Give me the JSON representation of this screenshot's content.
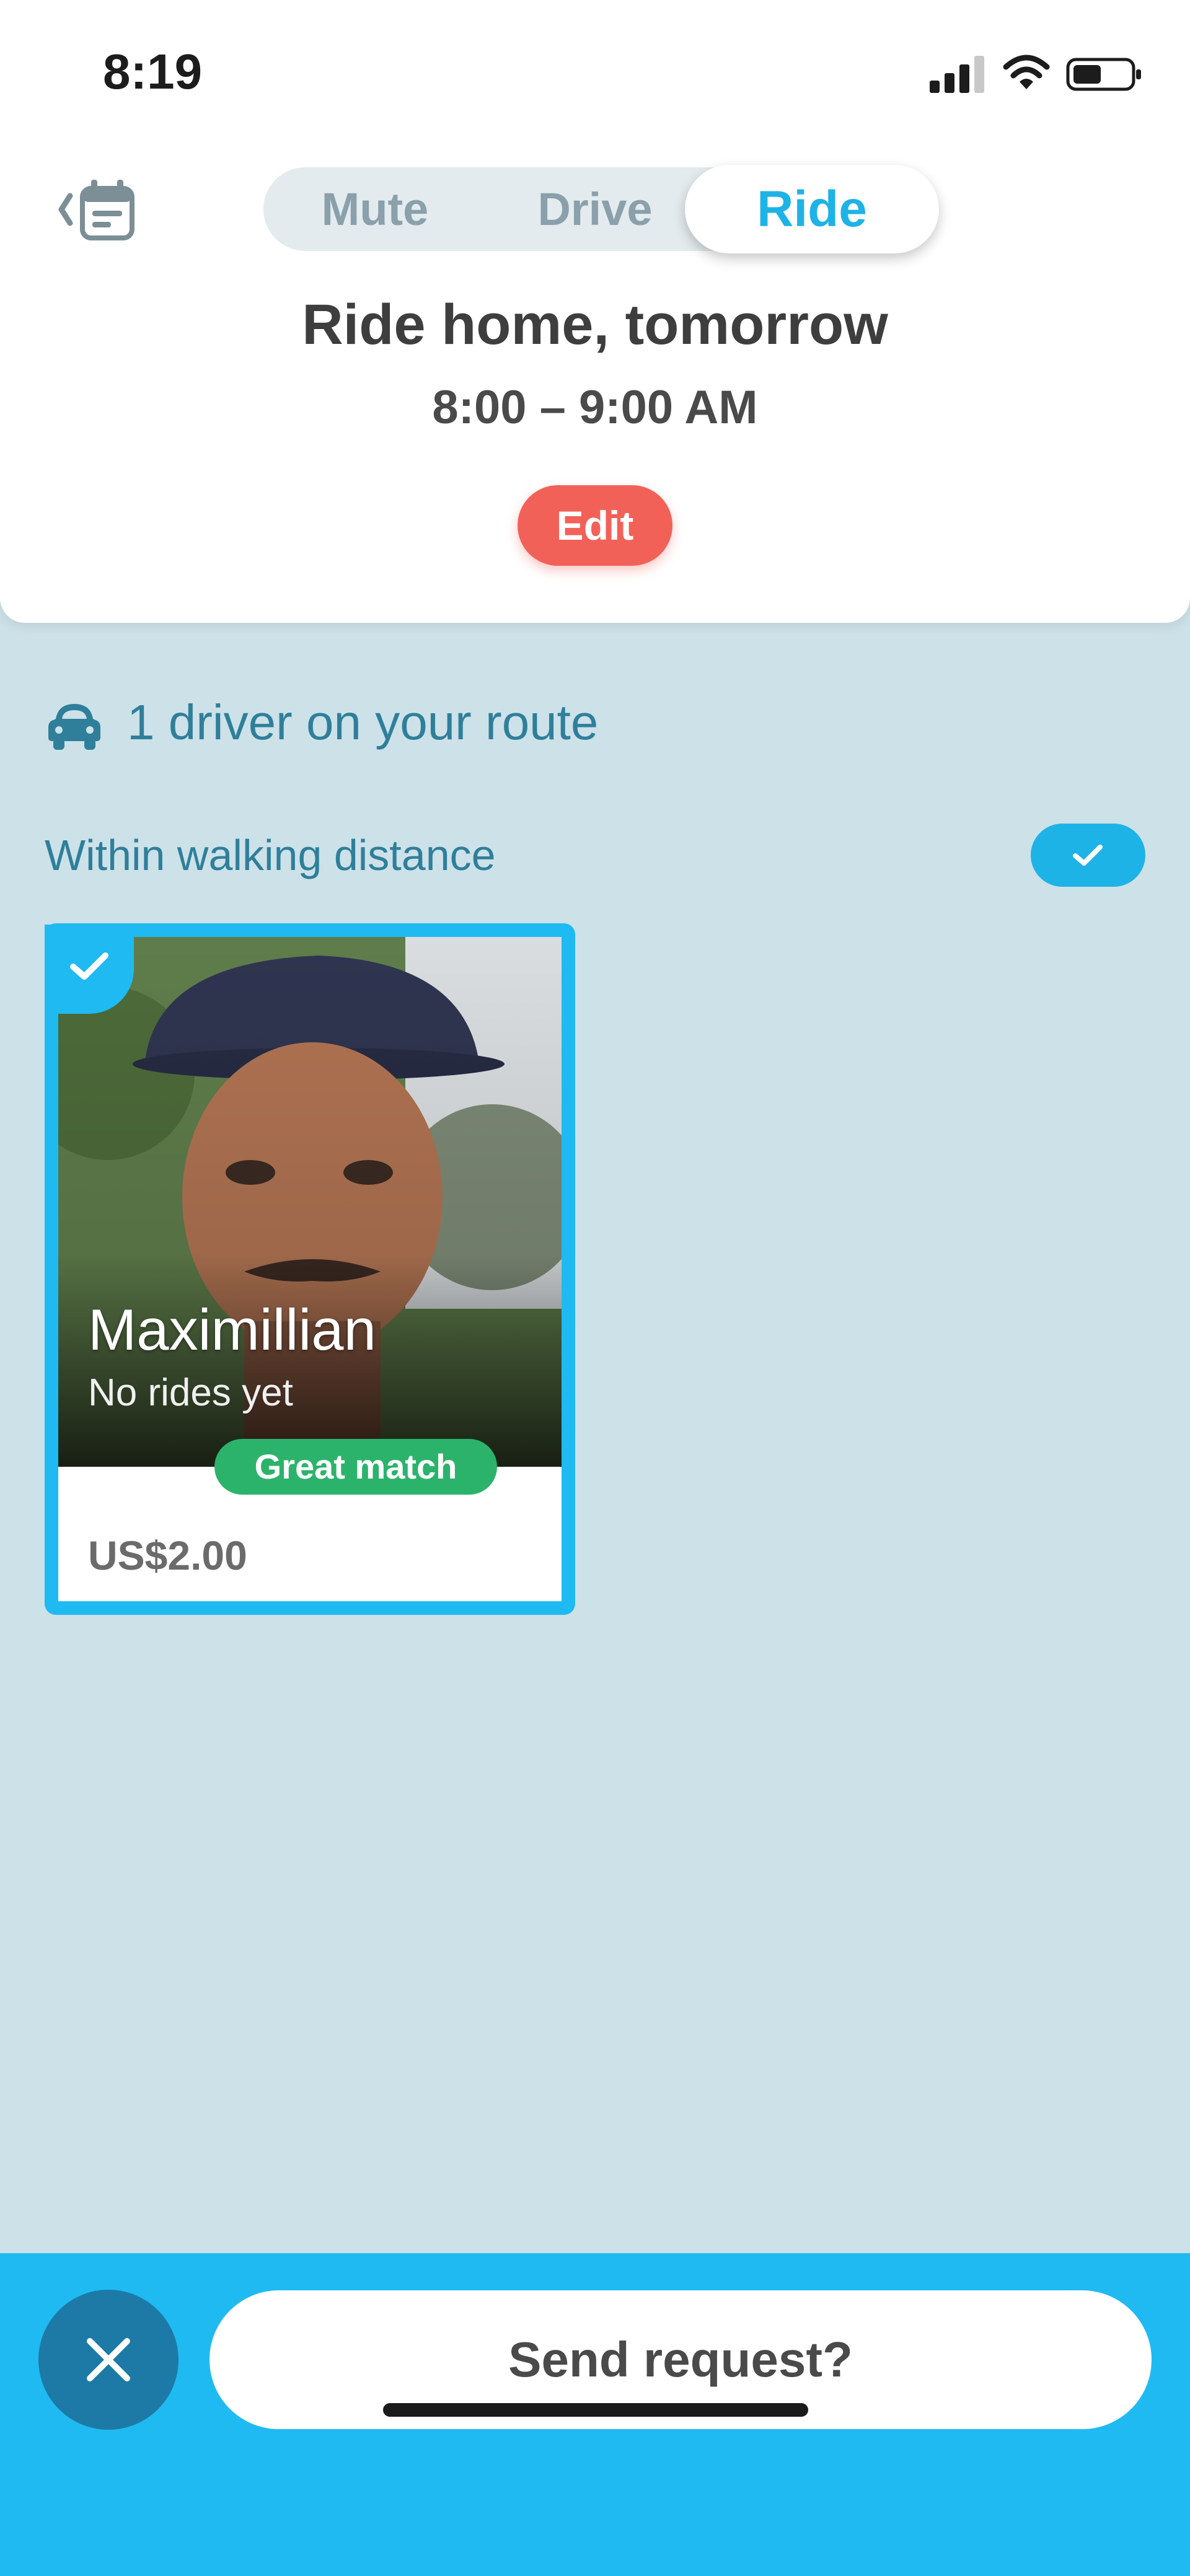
{
  "status_bar": {
    "time": "8:19"
  },
  "header": {
    "segments": [
      "Mute",
      "Drive",
      "Ride"
    ],
    "selected_segment": "Ride",
    "title": "Ride home, tomorrow",
    "time_range": "8:00 – 9:00 AM",
    "edit_label": "Edit"
  },
  "drivers": {
    "summary": "1 driver on your route",
    "filter_label": "Within walking distance",
    "filter_enabled": true
  },
  "card": {
    "name": "Maximillian",
    "rides": "No rides yet",
    "badge": "Great match",
    "price": "US$2.00",
    "selected": true
  },
  "actions": {
    "send_label": "Send request?"
  },
  "colors": {
    "accent": "#1fbaf2",
    "edit": "#f26158",
    "badge": "#2cb36b",
    "background": "#cde1e9"
  }
}
